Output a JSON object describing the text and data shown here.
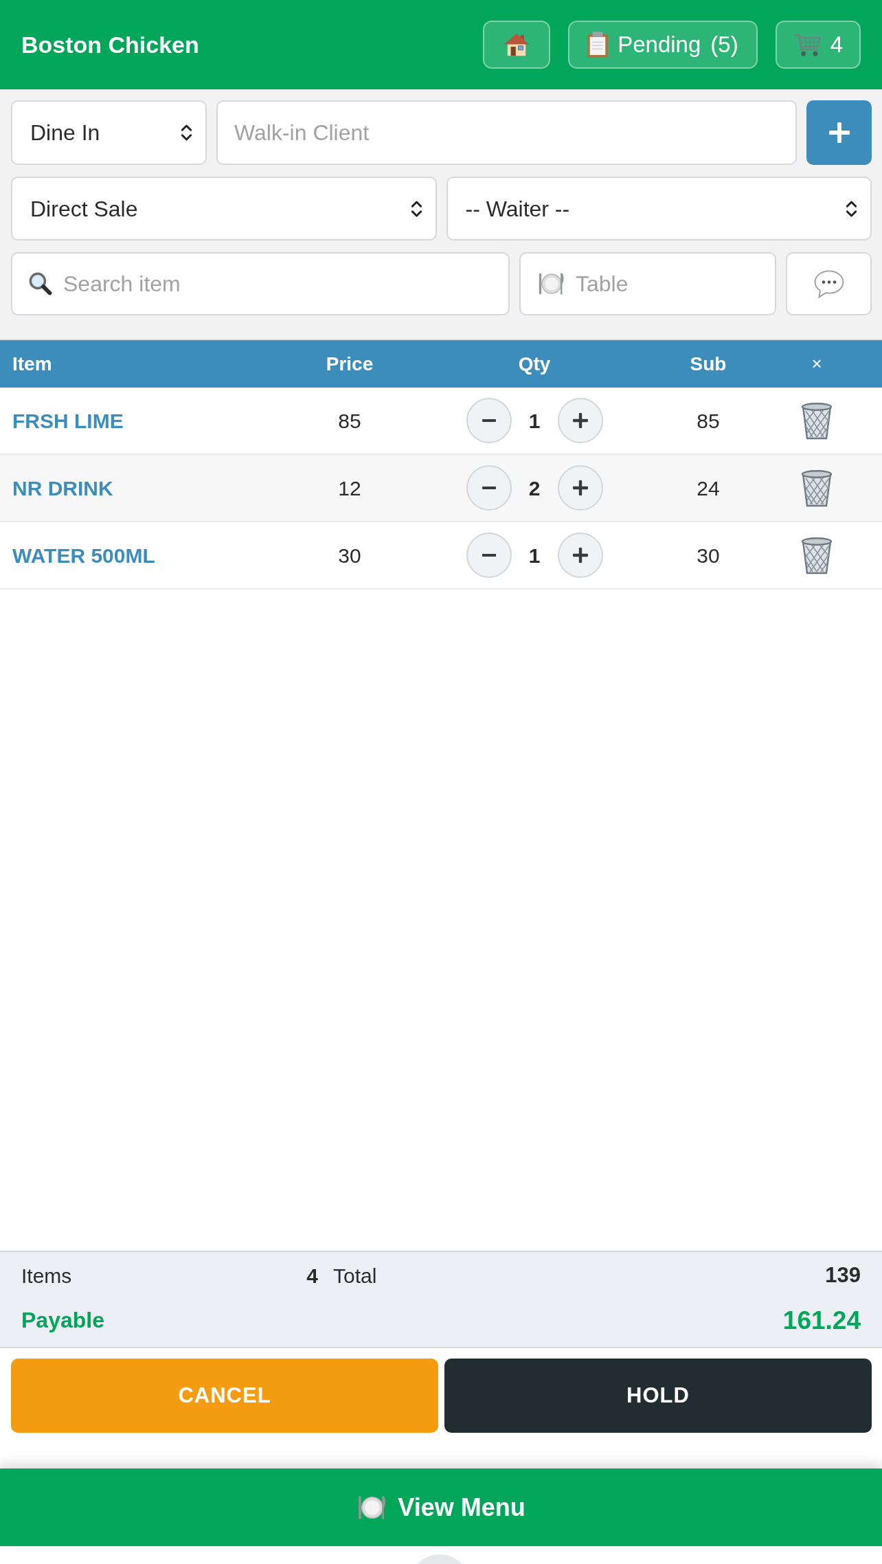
{
  "header": {
    "title": "Boston Chicken",
    "buttons": [
      {
        "kind": "home"
      },
      {
        "kind": "pending",
        "label": "Pending",
        "count": "(5)"
      },
      {
        "kind": "cart",
        "label": "4"
      }
    ]
  },
  "form": {
    "order_type": {
      "value": "Dine In"
    },
    "client": {
      "placeholder": "Walk-in Client"
    },
    "sale_type": {
      "value": "Direct Sale"
    },
    "waiter": {
      "value": "-- Waiter --"
    },
    "search": {
      "placeholder": "Search item"
    },
    "table": {
      "placeholder": "Table"
    }
  },
  "cart_table": {
    "columns": [
      "Item",
      "Price",
      "Qty",
      "Sub",
      "×"
    ],
    "rows": [
      {
        "item": "FRSH LIME",
        "price": "85",
        "qty": "1",
        "sub": "85"
      },
      {
        "item": "NR DRINK",
        "price": "12",
        "qty": "2",
        "sub": "24"
      },
      {
        "item": "WATER 500ML",
        "price": "30",
        "qty": "1",
        "sub": "30"
      }
    ]
  },
  "summary": {
    "items_label": "Items",
    "items_count": "4",
    "total_label": "Total",
    "total": "139",
    "payable_label": "Payable",
    "payable": "161.24"
  },
  "actions": [
    {
      "kind": "cancel",
      "label": "CANCEL"
    },
    {
      "kind": "hold",
      "label": "HOLD"
    }
  ],
  "bottom_bar": {
    "label": "View Menu"
  }
}
